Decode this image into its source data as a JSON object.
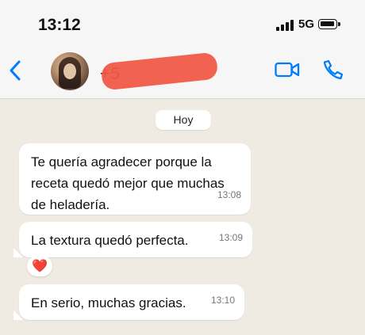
{
  "status_bar": {
    "time": "13:12",
    "network": "5G"
  },
  "header": {
    "contact_partial": "+5"
  },
  "date_chip": "Hoy",
  "messages": [
    {
      "text": "Te quería agradecer porque la\nreceta quedó mejor que muchas\nde heladería.",
      "time": "13:08"
    },
    {
      "text": "La textura quedó perfecta.",
      "time": "13:09"
    },
    {
      "text": "En serio, muchas gracias.",
      "time": "13:10"
    }
  ],
  "reaction": "❤️",
  "icons": [
    "back-icon",
    "video-call-icon",
    "phone-icon"
  ],
  "colors": {
    "accent": "#007aff",
    "background": "#efeae2"
  }
}
